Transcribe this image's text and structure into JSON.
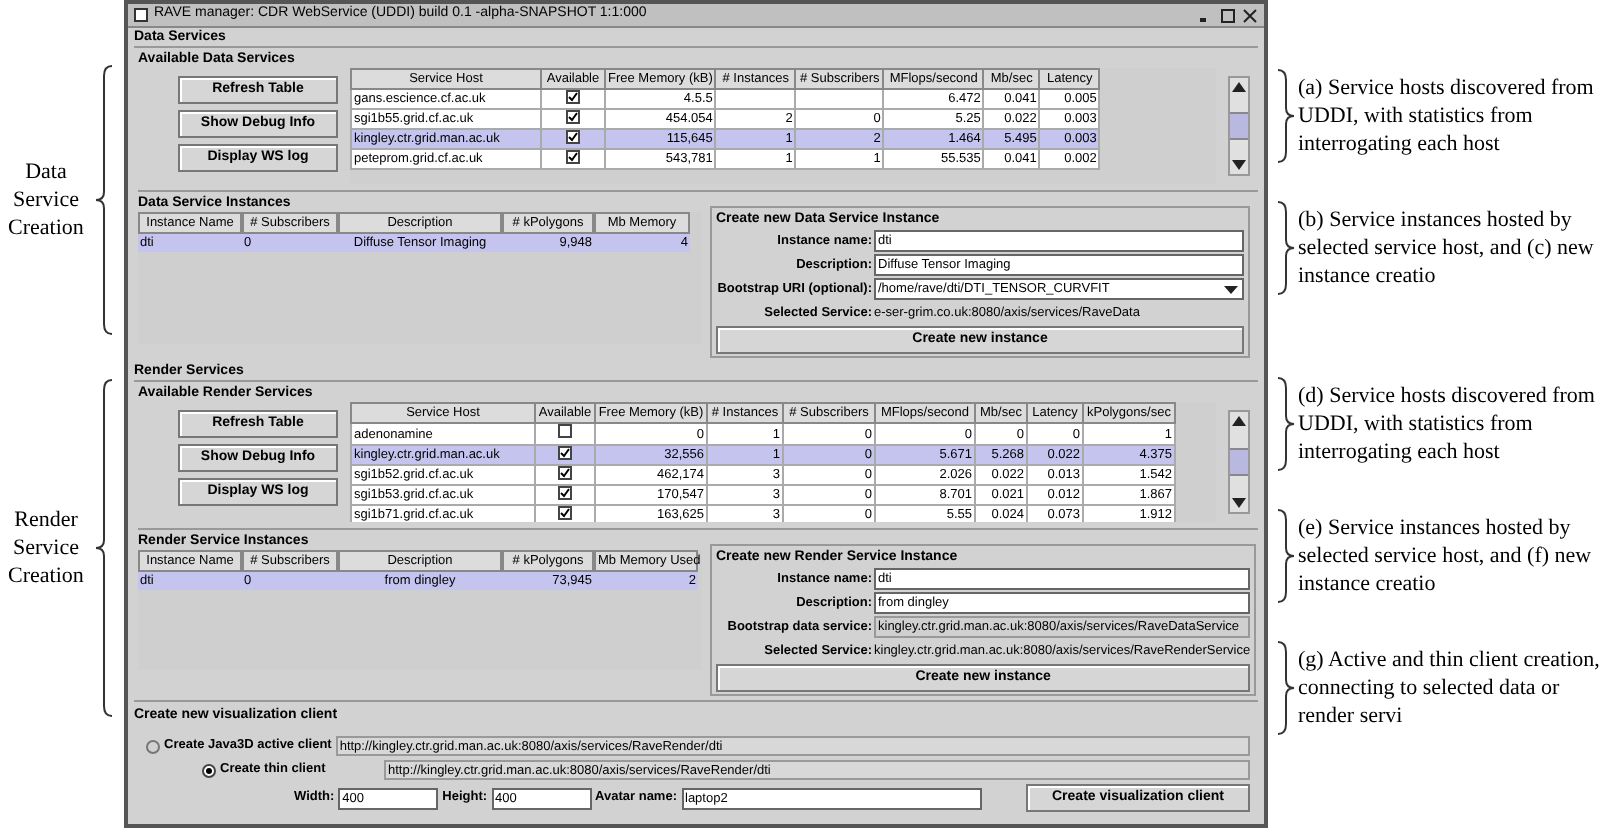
{
  "left_labels": [
    {
      "text": "Data Service Creation"
    },
    {
      "text": "Render Service Creation"
    }
  ],
  "window": {
    "title": "RAVE manager: CDR WebService (UDDI) build 0.1 -alpha-SNAPSHOT 1:1:000"
  },
  "data_services": {
    "title": "Data Services",
    "available": {
      "title": "Available Data Services",
      "buttons": [
        "Refresh Table",
        "Show Debug Info",
        "Display WS log"
      ],
      "table": {
        "columns": [
          "Service Host",
          "Available",
          "Free Memory (kB)",
          "# Instances",
          "# Subscribers",
          "MFlops/second",
          "Mb/sec",
          "Latency"
        ],
        "rows": [
          {
            "host": "gans.escience.cf.ac.uk",
            "available": true,
            "selected": false,
            "stats": {
              "free_memory": "4.5.5",
              "mflops": "6.472",
              "mb_sec": "0.041",
              "latency": "0.005"
            }
          },
          {
            "host": "sgi1b55.grid.cf.ac.uk",
            "available": true,
            "selected": false,
            "stats": {
              "free_memory": "454.054",
              "instances": "2",
              "subscribers": "0",
              "mflops": "5.25",
              "mb_sec": "0.022",
              "latency": "0.003"
            }
          },
          {
            "host": "kingley.ctr.grid.man.ac.uk",
            "available": true,
            "selected": true,
            "stats": {
              "free_memory": "115,645",
              "instances": "1",
              "subscribers": "2",
              "mflops": "1.464",
              "mb_sec": "5.495",
              "latency": "0.003"
            }
          },
          {
            "host": "peteprom.grid.cf.ac.uk",
            "available": true,
            "selected": false,
            "stats": {
              "free_memory": "543,781",
              "instances": "1",
              "subscribers": "1",
              "mflops": "55.535",
              "mb_sec": "0.041",
              "latency": "0.002"
            }
          }
        ]
      }
    },
    "instances": {
      "title": "Data Service Instances",
      "table": {
        "columns": [
          "Instance Name",
          "# Subscribers",
          "Description",
          "# kPolygons",
          "Mb Memory"
        ],
        "rows": [
          {
            "cells": [
              "dti",
              "0",
              "Diffuse Tensor Imaging",
              "9,948",
              "4"
            ],
            "selected": true
          }
        ]
      }
    },
    "create": {
      "title": "Create new Data Service Instance",
      "fields": [
        {
          "label": "Instance name:",
          "value": "dti",
          "kind": "input"
        },
        {
          "label": "Description:",
          "value": "Diffuse Tensor Imaging",
          "kind": "input"
        },
        {
          "label": "Bootstrap URI (optional):",
          "value": "/home/rave/dti/DTI_TENSOR_CURVFIT",
          "kind": "combo"
        },
        {
          "label": "Selected Service:",
          "value": "e-ser-grim.co.uk:8080/axis/services/RaveData",
          "kind": "plain"
        }
      ],
      "button": "Create new instance"
    }
  },
  "render_services": {
    "title": "Render Services",
    "available": {
      "title": "Available Render Services",
      "buttons": [
        "Refresh Table",
        "Show Debug Info",
        "Display WS log"
      ],
      "table": {
        "columns": [
          "Service Host",
          "Available",
          "Free Memory (kB)",
          "# Instances",
          "# Subscribers",
          "MFlops/second",
          "Mb/sec",
          "Latency",
          "kPolygons/sec"
        ],
        "rows": [
          {
            "host": "adenonamine",
            "available": false,
            "selected": false,
            "stats": {
              "free_memory": "0",
              "instances": "1",
              "subscribers": "0",
              "mflops": "0",
              "mb_sec": "0",
              "latency": "0",
              "kpolygons": "1"
            }
          },
          {
            "host": "kingley.ctr.grid.man.ac.uk",
            "available": true,
            "selected": true,
            "stats": {
              "free_memory": "32,556",
              "instances": "1",
              "subscribers": "0",
              "mflops": "5.671",
              "mb_sec": "5.268",
              "latency": "0.022",
              "kpolygons": "4.375"
            }
          },
          {
            "host": "sgi1b52.grid.cf.ac.uk",
            "available": true,
            "selected": false,
            "stats": {
              "free_memory": "462,174",
              "instances": "3",
              "subscribers": "0",
              "mflops": "2.026",
              "mb_sec": "0.022",
              "latency": "0.013",
              "kpolygons": "1.542"
            }
          },
          {
            "host": "sgi1b53.grid.cf.ac.uk",
            "available": true,
            "selected": false,
            "stats": {
              "free_memory": "170,547",
              "instances": "3",
              "subscribers": "0",
              "mflops": "8.701",
              "mb_sec": "0.021",
              "latency": "0.012",
              "kpolygons": "1.867"
            }
          },
          {
            "host": "sgi1b71.grid.cf.ac.uk",
            "available": true,
            "selected": false,
            "stats": {
              "free_memory": "163,625",
              "instances": "3",
              "subscribers": "0",
              "mflops": "5.55",
              "mb_sec": "0.024",
              "latency": "0.073",
              "kpolygons": "1.912"
            }
          }
        ]
      }
    },
    "instances": {
      "title": "Render Service Instances",
      "table": {
        "columns": [
          "Instance Name",
          "# Subscribers",
          "Description",
          "# kPolygons",
          "Mb Memory Used"
        ],
        "rows": [
          {
            "cells": [
              "dti",
              "0",
              "from dingley",
              "73,945",
              "2"
            ],
            "selected": true
          }
        ]
      }
    },
    "create": {
      "title": "Create new Render Service Instance",
      "fields": [
        {
          "label": "Instance name:",
          "value": "dti",
          "kind": "input"
        },
        {
          "label": "Description:",
          "value": "from dingley",
          "kind": "input"
        },
        {
          "label": "Bootstrap data service:",
          "value": "kingley.ctr.grid.man.ac.uk:8080/axis/services/RaveDataService",
          "kind": "readonly"
        },
        {
          "label": "Selected Service:",
          "value": "kingley.ctr.grid.man.ac.uk:8080/axis/services/RaveRenderService",
          "kind": "plain"
        }
      ],
      "button": "Create new instance"
    }
  },
  "viz": {
    "title": "Create new visualization client",
    "clients": [
      {
        "label": "Create Java3D active client",
        "url": "http://kingley.ctr.grid.man.ac.uk:8080/axis/services/RaveRender/dti",
        "selected": false
      },
      {
        "label": "Create thin client",
        "url": "http://kingley.ctr.grid.man.ac.uk:8080/axis/services/RaveRender/dti",
        "selected": true
      }
    ],
    "fields": [
      {
        "label": "Width:",
        "value": "400"
      },
      {
        "label": "Height:",
        "value": "400"
      },
      {
        "label": "Avatar name:",
        "value": "laptop2"
      }
    ],
    "button": "Create visualization client"
  },
  "annotations": [
    {
      "text": "(a) Service hosts discovered from UDDI, with statistics from interrogating each host"
    },
    {
      "text": "(b) Service instances hosted by selected service host, and (c) new instance creatio"
    },
    {
      "text": "(d) Service hosts discovered from UDDI, with statistics from interrogating each host"
    },
    {
      "text": "(e) Service instances hosted by selected service host, and (f) new instance creatio"
    },
    {
      "text": "(g) Active and thin client creation, connecting to selected data or render servi"
    }
  ]
}
